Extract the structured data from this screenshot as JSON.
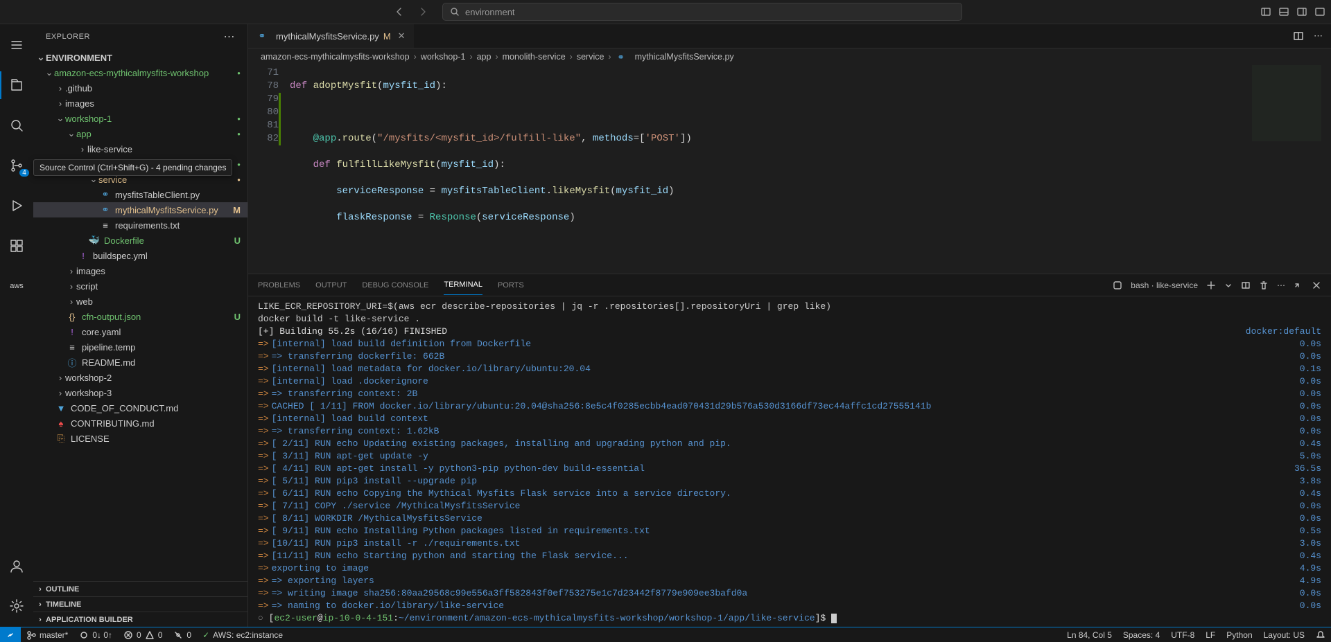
{
  "titlebar": {
    "search_text": "environment"
  },
  "sidebar": {
    "title": "EXPLORER",
    "root": "ENVIRONMENT",
    "sections": {
      "outline": "OUTLINE",
      "timeline": "TIMELINE",
      "appbuilder": "APPLICATION BUILDER"
    }
  },
  "tree": {
    "workshop_root": "amazon-ecs-mythicalmysfits-workshop",
    "github": ".github",
    "images": "images",
    "workshop1": "workshop-1",
    "app": "app",
    "like_service": "like-service",
    "monolith_service": "monolith-service",
    "service": "service",
    "mysfits_table": "mysfitsTableClient.py",
    "mythical_service": "mythicalMysfitsService.py",
    "requirements": "requirements.txt",
    "dockerfile": "Dockerfile",
    "buildspec": "buildspec.yml",
    "images2": "images",
    "script": "script",
    "web": "web",
    "cfn_output": "cfn-output.json",
    "core_yaml": "core.yaml",
    "pipeline": "pipeline.temp",
    "readme": "README.md",
    "workshop2": "workshop-2",
    "workshop3": "workshop-3",
    "code_of_conduct": "CODE_OF_CONDUCT.md",
    "contributing": "CONTRIBUTING.md",
    "license": "LICENSE",
    "status_m": "M",
    "status_u": "U"
  },
  "tooltip": {
    "scm": "Source Control (Ctrl+Shift+G) - 4 pending changes"
  },
  "scm_badge": "4",
  "tab": {
    "filename": "mythicalMysfitsService.py",
    "status": "M"
  },
  "breadcrumb": {
    "p1": "amazon-ecs-mythicalmysfits-workshop",
    "p2": "workshop-1",
    "p3": "app",
    "p4": "monolith-service",
    "p5": "service",
    "p6": "mythicalMysfitsService.py"
  },
  "code": {
    "line_numbers": [
      "71",
      "78",
      "79",
      "80",
      "81",
      "82"
    ],
    "l71_def": "def",
    "l71_fn": "adoptMysfit",
    "l71_param": "mysfit_id",
    "l79_decorator": "@app",
    "l79_route": "route",
    "l79_url": "\"/mysfits/<mysfit_id>/fulfill-like\"",
    "l79_methods_kw": "methods",
    "l79_methods_val": "'POST'",
    "l80_def": "def",
    "l80_fn": "fulfillLikeMysfit",
    "l80_param": "mysfit_id",
    "l81_var": "serviceResponse",
    "l81_obj": "mysfitsTableClient",
    "l81_method": "likeMysfit",
    "l81_arg": "mysfit_id",
    "l82_var": "flaskResponse",
    "l82_cls": "Response",
    "l82_arg": "serviceResponse"
  },
  "panel": {
    "problems": "PROBLEMS",
    "output": "OUTPUT",
    "debug": "DEBUG CONSOLE",
    "terminal": "TERMINAL",
    "ports": "PORTS",
    "shell_label": "bash · like-service"
  },
  "terminal": {
    "cmd1": "LIKE_ECR_REPOSITORY_URI=$(aws ecr describe-repositories | jq -r .repositories[].repositoryUri | grep like)",
    "cmd2": "docker build -t like-service .",
    "building": "[+] Building 55.2s (16/16) FINISHED",
    "docker_default": "docker:default",
    "steps": [
      {
        "txt": "[internal] load build definition from Dockerfile",
        "time": "0.0s"
      },
      {
        "txt": "=> transferring dockerfile: 662B",
        "time": "0.0s"
      },
      {
        "txt": "[internal] load metadata for docker.io/library/ubuntu:20.04",
        "time": "0.1s"
      },
      {
        "txt": "[internal] load .dockerignore",
        "time": "0.0s"
      },
      {
        "txt": "=> transferring context: 2B",
        "time": "0.0s"
      },
      {
        "txt": "CACHED [ 1/11] FROM docker.io/library/ubuntu:20.04@sha256:8e5c4f0285ecbb4ead070431d29b576a530d3166df73ec44affc1cd27555141b",
        "time": "0.0s"
      },
      {
        "txt": "[internal] load build context",
        "time": "0.0s"
      },
      {
        "txt": "=> transferring context: 1.62kB",
        "time": "0.0s"
      },
      {
        "txt": "[ 2/11] RUN echo Updating existing packages, installing and upgrading python and pip.",
        "time": "0.4s"
      },
      {
        "txt": "[ 3/11] RUN apt-get update -y",
        "time": "5.0s"
      },
      {
        "txt": "[ 4/11] RUN apt-get install -y python3-pip python-dev build-essential",
        "time": "36.5s"
      },
      {
        "txt": "[ 5/11] RUN pip3 install --upgrade pip",
        "time": "3.8s"
      },
      {
        "txt": "[ 6/11] RUN echo Copying the Mythical Mysfits Flask service into a service directory.",
        "time": "0.4s"
      },
      {
        "txt": "[ 7/11] COPY ./service /MythicalMysfitsService",
        "time": "0.0s"
      },
      {
        "txt": "[ 8/11] WORKDIR /MythicalMysfitsService",
        "time": "0.0s"
      },
      {
        "txt": "[ 9/11] RUN echo Installing Python packages listed in requirements.txt",
        "time": "0.5s"
      },
      {
        "txt": "[10/11] RUN pip3 install -r ./requirements.txt",
        "time": "3.0s"
      },
      {
        "txt": "[11/11] RUN echo Starting python and starting the Flask service...",
        "time": "0.4s"
      },
      {
        "txt": "exporting to image",
        "time": "4.9s"
      },
      {
        "txt": "=> exporting layers",
        "time": "4.9s"
      },
      {
        "txt": "=> writing image sha256:80aa29568c99e556a3ff582843f0ef753275e1c7d23442f8779e909ee3bafd0a",
        "time": "0.0s"
      },
      {
        "txt": "=> naming to docker.io/library/like-service",
        "time": "0.0s"
      }
    ],
    "prompt_user": "ec2-user",
    "prompt_host": "ip-10-0-4-151",
    "prompt_path": "~/environment/amazon-ecs-mythicalmysfits-workshop/workshop-1/app/like-service"
  },
  "statusbar": {
    "branch": "master*",
    "sync": "0↓ 0↑",
    "errors": "0",
    "warnings": "0",
    "port": "0",
    "aws": "AWS: ec2:instance",
    "ln_col": "Ln 84, Col 5",
    "spaces": "Spaces: 4",
    "encoding": "UTF-8",
    "eol": "LF",
    "lang": "Python",
    "layout": "Layout: US"
  }
}
